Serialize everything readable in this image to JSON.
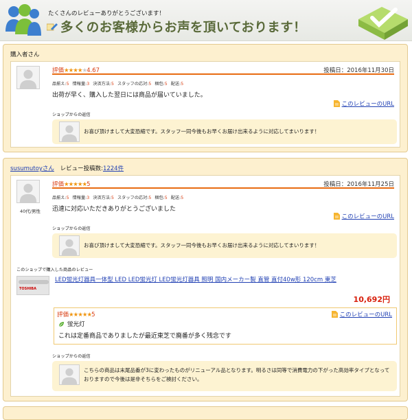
{
  "banner": {
    "line1": "たくさんのレビューありがとうございます！",
    "line2": "多くのお客様からお声を頂いております！"
  },
  "reviews": [
    {
      "reviewer": "購入者さん",
      "rating_label": "評価",
      "stars_filled": 4,
      "stars_total": 5,
      "score": "4.67",
      "date": "投稿日：2016年11月30日",
      "subratings": [
        {
          "label": "品揃え:",
          "value": "5"
        },
        {
          "label": "情報量:",
          "value": "3"
        },
        {
          "label": "決済方法:",
          "value": "5"
        },
        {
          "label": "スタッフの応対:",
          "value": "5"
        },
        {
          "label": "梱包:",
          "value": "5"
        },
        {
          "label": "配送:",
          "value": "5"
        }
      ],
      "body": "出荷が早く、購入した翌日には商品が届いていました。",
      "url_label": "このレビューのURL",
      "shop_reply_label": "ショップからの返信",
      "shop_reply": "お喜び頂けまして大変恐縮です。スタッフ一同今後もお早くお届け出来るように対応してまいります！"
    },
    {
      "reviewer": "susumutoyさん",
      "review_count_label": "レビュー投稿数:",
      "review_count": "1224件",
      "demographic": "40代/男性",
      "rating_label": "評価",
      "stars_filled": 5,
      "stars_total": 5,
      "score": "5",
      "date": "投稿日：2016年11月25日",
      "subratings": [
        {
          "label": "品揃え:",
          "value": "5"
        },
        {
          "label": "情報量:",
          "value": "3"
        },
        {
          "label": "決済方法:",
          "value": "5"
        },
        {
          "label": "スタッフの応対:",
          "value": "5"
        },
        {
          "label": "梱包:",
          "value": "5"
        },
        {
          "label": "配送:",
          "value": "5"
        }
      ],
      "body": "迅速に対応いただきありがとうございました",
      "url_label": "このレビューのURL",
      "shop_reply_label": "ショップからの返信",
      "shop_reply": "お喜び頂けまして大変恐縮です。スタッフ一同今後もお早くお届け出来るように対応してまいります！",
      "product": {
        "header": "このショップで購入した商品のレビュー",
        "name": "LED蛍光灯器具一体型 LED LED蛍光灯 LED蛍光灯器具 照明 国内メーカー製 直管 直付40w形 120cm 東芝",
        "image_brand": "TOSHIBA",
        "price": "10,692円",
        "rating_label": "評価",
        "stars_filled": 5,
        "score": "5",
        "url_label": "このレビューのURL",
        "tag": "蛍光灯",
        "body": "これは定番商品でありましたが最近東芝で廃番が多く残念です",
        "shop_reply_label": "ショップからの返信",
        "shop_reply": "こちらの商品は末尾品番が3に変わったものがリニューアル品となります。明るさは同等で消費電力の下がった高効率タイプとなっておりますので今後は是非そちらをご検討ください。"
      }
    }
  ]
}
